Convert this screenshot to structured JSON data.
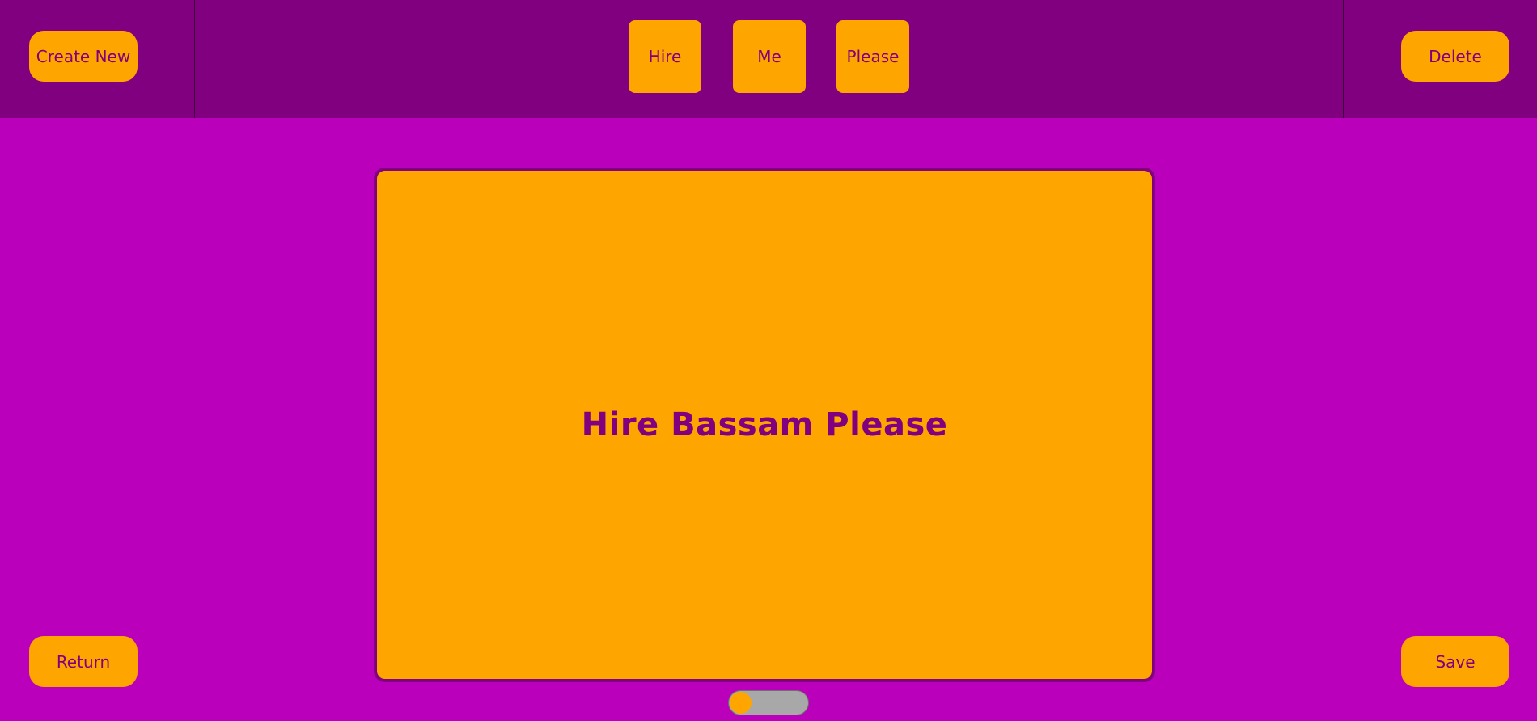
{
  "colors": {
    "header_bg": "#800080",
    "page_bg": "#bb00bb",
    "accent": "#ffa500",
    "text": "#800080",
    "toggle_track": "#a8a8a8"
  },
  "header": {
    "create_new_label": "Create New",
    "delete_label": "Delete",
    "word_buttons": [
      "Hire",
      "Me",
      "Please"
    ]
  },
  "card": {
    "text": "Hire Bassam Please"
  },
  "footer": {
    "return_label": "Return",
    "save_label": "Save"
  },
  "toggle": {
    "state": "off"
  }
}
